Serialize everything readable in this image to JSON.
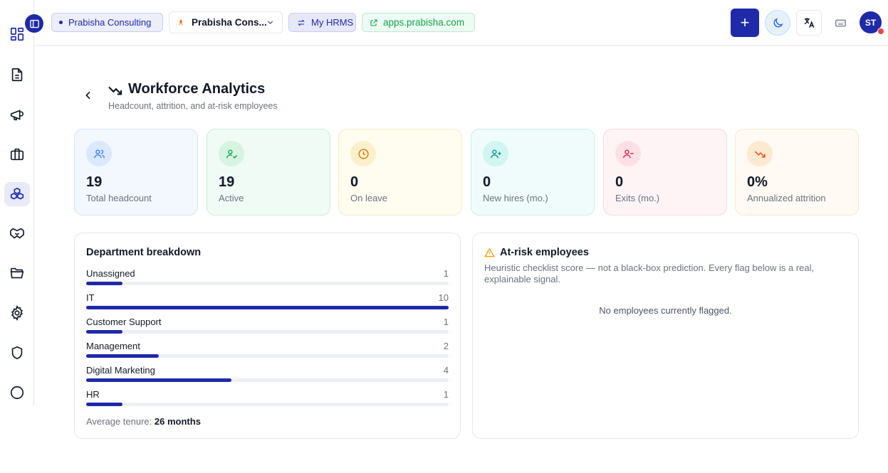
{
  "header": {
    "org_label": "Prabisha Consulting",
    "company_select": "Prabisha Cons...",
    "hrms_label": "My HRMS",
    "site_link": "apps.prabisha.com",
    "add_label": "+",
    "avatar_initials": "ST"
  },
  "page": {
    "title": "Workforce Analytics",
    "subtitle": "Headcount, attrition, and at-risk employees"
  },
  "stats": [
    {
      "value": "19",
      "label": "Total headcount",
      "icon": "users-icon",
      "color": "#3b82f6"
    },
    {
      "value": "19",
      "label": "Active",
      "icon": "user-check-icon",
      "color": "#16a34a"
    },
    {
      "value": "0",
      "label": "On leave",
      "icon": "clock-icon",
      "color": "#d97706"
    },
    {
      "value": "0",
      "label": "New hires (mo.)",
      "icon": "user-plus-icon",
      "color": "#0d9488"
    },
    {
      "value": "0",
      "label": "Exits (mo.)",
      "icon": "user-minus-icon",
      "color": "#e11d48"
    },
    {
      "value": "0%",
      "label": "Annualized attrition",
      "icon": "trending-down-icon",
      "color": "#ea580c"
    }
  ],
  "departments": {
    "title": "Department breakdown",
    "rows": [
      {
        "name": "Unassigned",
        "count": "1",
        "share": 0.1
      },
      {
        "name": "IT",
        "count": "10",
        "share": 1.0
      },
      {
        "name": "Customer Support",
        "count": "1",
        "share": 0.1
      },
      {
        "name": "Management",
        "count": "2",
        "share": 0.2
      },
      {
        "name": "Digital Marketing",
        "count": "4",
        "share": 0.4
      },
      {
        "name": "HR",
        "count": "1",
        "share": 0.1
      }
    ],
    "tenure_label": "Average tenure:",
    "tenure_value": "26 months"
  },
  "at_risk": {
    "title": "At-risk employees",
    "description": "Heuristic checklist score — not a black-box prediction. Every flag below is a real, explainable signal.",
    "empty_message": "No employees currently flagged."
  },
  "sidebar": {
    "items": [
      {
        "icon": "dashboard-icon"
      },
      {
        "icon": "document-icon"
      },
      {
        "icon": "megaphone-icon"
      },
      {
        "icon": "briefcase-icon"
      },
      {
        "icon": "cubes-icon",
        "active": true
      },
      {
        "icon": "handshake-icon"
      },
      {
        "icon": "folder-icon"
      },
      {
        "icon": "gear-icon"
      },
      {
        "icon": "shield-icon"
      },
      {
        "icon": "circle-icon"
      }
    ]
  },
  "colors": {
    "accent": "#1e2aa8",
    "link_green": "#16a34a",
    "notification": "#ef4444"
  }
}
